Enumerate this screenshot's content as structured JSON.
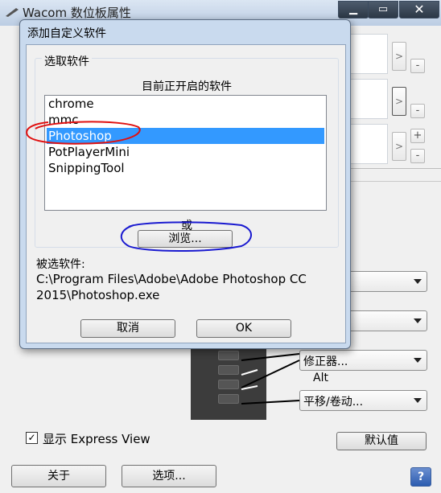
{
  "main_window": {
    "title": "Wacom 数位板属性",
    "window_buttons": {
      "minimize": "▁",
      "maximize": "▭",
      "close": "✕"
    },
    "app_slots": [
      {
        "arrow": ">",
        "action": "-"
      },
      {
        "arrow": ">",
        "action": "-"
      },
      {
        "arrow": ">",
        "action_top": "+",
        "action": "-"
      }
    ],
    "dropdowns": [
      {
        "value": ""
      },
      {
        "value": ""
      },
      {
        "value": "修正器..."
      },
      {
        "value": "平移/卷动..."
      }
    ],
    "alt_label": "Alt",
    "express_view": {
      "checked_mark": "✓",
      "label": "显示 Express View"
    },
    "default_button": "默认值",
    "about_button": "关于",
    "options_button": "选项...",
    "help_button": "?"
  },
  "dialog": {
    "title": "添加自定义软件",
    "group_title": "选取软件",
    "list_header": "目前正开启的软件",
    "apps": [
      "chrome",
      "mmc",
      "Photoshop",
      "PotPlayerMini",
      "SnippingTool"
    ],
    "selected_app": "Photoshop",
    "or_label": "或",
    "browse_button": "浏览...",
    "selected_label": "被选软件:",
    "selected_path": "C:\\Program Files\\Adobe\\Adobe Photoshop CC 2015\\Photoshop.exe",
    "cancel_button": "取消",
    "ok_button": "OK"
  },
  "annotations": {
    "colors": {
      "photoshop_circle": "#e01010",
      "browse_circle": "#1a1ad0"
    }
  },
  "colors": {
    "selection": "#3399ff",
    "titlebar": "#c6d6ea",
    "dialog_frame": "#c9daee"
  }
}
